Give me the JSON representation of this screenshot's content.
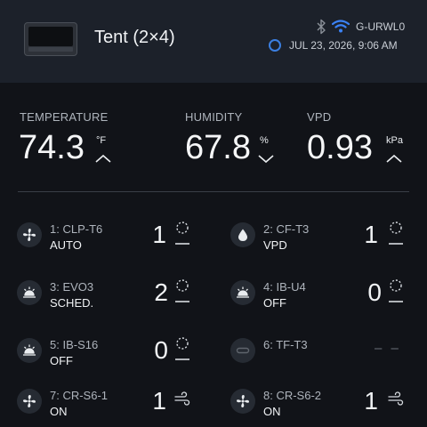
{
  "header": {
    "device_title": "Tent (2×4)",
    "network_name": "G-URWL0",
    "datetime": "JUL 23, 2026, 9:06 AM",
    "icons": [
      "controller-device-icon",
      "bluetooth-icon",
      "wifi-icon",
      "status-ring-icon"
    ],
    "accent_color": "#3b7fe0"
  },
  "metrics": {
    "temperature": {
      "label": "TEMPERATURE",
      "value": "74.3",
      "unit": "°F",
      "trend": "up"
    },
    "humidity": {
      "label": "HUMIDITY",
      "value": "67.8",
      "unit": "%",
      "trend": "down"
    },
    "vpd": {
      "label": "VPD",
      "value": "0.93",
      "unit": "kPa",
      "trend": "up"
    }
  },
  "ports": [
    {
      "name": "1: CLP-T6",
      "mode": "AUTO",
      "level": "1",
      "icon": "fan-icon",
      "status_icon": "dotted-circle-icon"
    },
    {
      "name": "2: CF-T3",
      "mode": "VPD",
      "level": "1",
      "icon": "droplet-icon",
      "status_icon": "dotted-circle-icon"
    },
    {
      "name": "3: EVO3",
      "mode": "SCHED.",
      "level": "2",
      "icon": "grow-light-icon",
      "status_icon": "dotted-circle-icon"
    },
    {
      "name": "4: IB-U4",
      "mode": "OFF",
      "level": "0",
      "icon": "grow-light-icon",
      "status_icon": "dotted-circle-icon"
    },
    {
      "name": "5: IB-S16",
      "mode": "OFF",
      "level": "0",
      "icon": "grow-light-icon",
      "status_icon": "dotted-circle-icon"
    },
    {
      "name": "6: TF-T3",
      "mode": "",
      "level": "– –",
      "icon": "unplugged-icon",
      "status_icon": ""
    },
    {
      "name": "7: CR-S6-1",
      "mode": "ON",
      "level": "1",
      "icon": "fan-icon",
      "status_icon": "wind-icon"
    },
    {
      "name": "8: CR-S6-2",
      "mode": "ON",
      "level": "1",
      "icon": "fan-icon",
      "status_icon": "wind-icon"
    }
  ]
}
